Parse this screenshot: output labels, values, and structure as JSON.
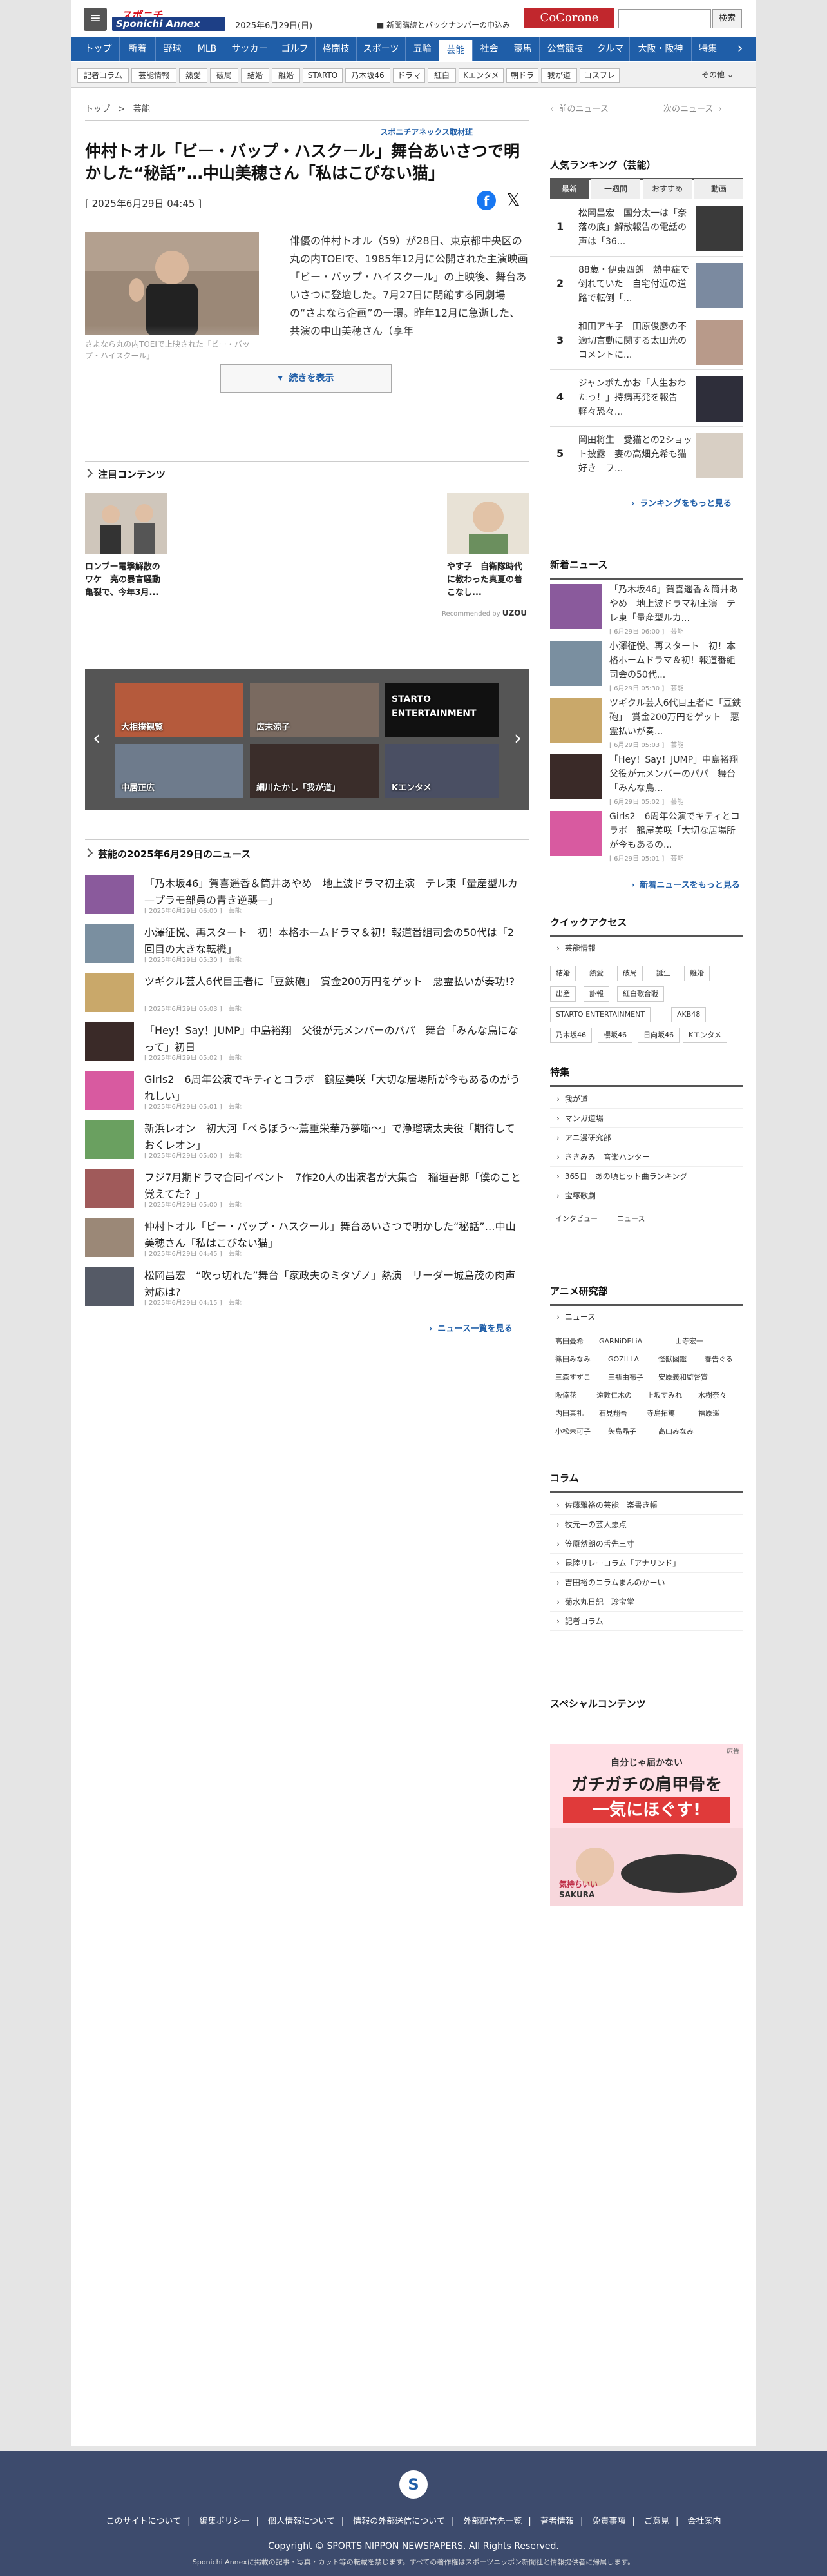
{
  "header": {
    "logo_top": "スポニチ",
    "logo_main": "Sponichi Annex",
    "date": "2025年6月29日(日)",
    "note": "■ 新聞購読とバックナンバーの申込み",
    "cocorone": "CoCorone",
    "search_button": "検索"
  },
  "nav": [
    "トップ",
    "新着",
    "野球",
    "MLB",
    "サッカー",
    "ゴルフ",
    "格闘技",
    "スポーツ",
    "五輪",
    "芸能",
    "社会",
    "競馬",
    "公営競技",
    "クルマ",
    "大阪・阪神",
    "特集"
  ],
  "subnav": {
    "items": [
      "記者コラム",
      "芸能情報",
      "熱愛",
      "破局",
      "結婚",
      "離婚",
      "STARTO",
      "乃木坂46",
      "ドラマ",
      "紅白",
      "Kエンタメ",
      "朝ドラ",
      "我が道",
      "コスプレ"
    ],
    "more": "その他"
  },
  "breadcrumb": {
    "top": "トップ",
    "sep": ">",
    "current": "芸能"
  },
  "pager": {
    "prev": "前のニュース",
    "next": "次のニュース"
  },
  "article": {
    "source": "スポニチアネックス取材班",
    "title": "仲村トオル「ビー・バップ・ハスクール」舞台あいさつで明かした“秘話”…中山美穂さん「私はこびない猫」",
    "date": "[ 2025年6月29日 04:45 ]",
    "body": "俳優の仲村トオル（59）が28日、東京都中央区の丸の内TOEIで、1985年12月に公開された主演映画「ビー・バップ・ハイスクール」の上映後、舞台あいさつに登壇した。7月27日に閉館する同劇場の“さよなら企画”の一環。昨年12月に急逝した、共演の中山美穂さん（享年",
    "caption": "さよなら丸の内TOEIで上映された「ビー・バップ・ハイスクール」",
    "more_button": "続きを表示"
  },
  "attention": {
    "title": "注目コンテンツ",
    "cards": [
      {
        "text": "ロンブー電撃解散のワケ　亮の暴言騒動 亀裂で、今年3月..."
      },
      {
        "text": "やす子　自衛隊時代に教わった真夏の着こなし..."
      }
    ],
    "recommended": "Recommended by",
    "recommended_brand": "UZOU"
  },
  "carousel": {
    "tiles": [
      "大相撲観覧",
      "広末涼子",
      "STARTO ENTERTAINMENT",
      "中居正広",
      "細川たかし「我が道」",
      "Kエンタメ"
    ]
  },
  "news_list": {
    "title": "芸能の2025年6月29日のニュース",
    "items": [
      {
        "title": "「乃木坂46」賀喜遥香＆筒井あやめ　地上波ドラマ初主演　テレ東「量産型ルカ—プラモ部員の青き逆襲—」",
        "date": "[ 2025年6月29日 06:00 ]　芸能"
      },
      {
        "title": "小澤征悦、再スタート　初！本格ホームドラマ＆初！報道番組司会の50代は「2回目の大きな転機」",
        "date": "[ 2025年6月29日 05:30 ]　芸能"
      },
      {
        "title": "ツギクル芸人6代目王者に「豆鉄砲」　賞金200万円をゲット　悪霊払いが奏功!?",
        "date": "[ 2025年6月29日 05:03 ]　芸能"
      },
      {
        "title": "「Hey！Say！JUMP」中島裕翔　父役が元メンバーのパパ　舞台「みんな鳥になって」初日",
        "date": "[ 2025年6月29日 05:02 ]　芸能"
      },
      {
        "title": "Girls2　6周年公演でキティとコラボ　鶴屋美咲「大切な居場所が今もあるのがうれしい」",
        "date": "[ 2025年6月29日 05:01 ]　芸能"
      },
      {
        "title": "新浜レオン　初大河「べらぼう〜蔦重栄華乃夢噺〜」で浄瑠璃太夫役「期待しておくレオン」",
        "date": "[ 2025年6月29日 05:00 ]　芸能"
      },
      {
        "title": "フジ7月期ドラマ合同イベント　7作20人の出演者が大集合　稲垣吾郎「僕のこと覚えてた？」",
        "date": "[ 2025年6月29日 05:00 ]　芸能"
      },
      {
        "title": "仲村トオル「ビー・バップ・ハスクール」舞台あいさつで明かした“秘話”…中山美穂さん「私はこびない猫」",
        "date": "[ 2025年6月29日 04:45 ]　芸能"
      },
      {
        "title": "松岡昌宏　“吹っ切れた”舞台「家政夫のミタゾノ」熱演　リーダー城島茂の肉声対応は?",
        "date": "[ 2025年6月29日 04:15 ]　芸能"
      }
    ],
    "more": "ニュース一覧を見る"
  },
  "ranking": {
    "title": "人気ランキング（芸能）",
    "tabs": [
      "最新",
      "一週間",
      "おすすめ",
      "動画"
    ],
    "items": [
      {
        "rank": "1",
        "text": "松岡昌宏　国分太一は「奈落の底」解散報告の電話の声は「36..."
      },
      {
        "rank": "2",
        "text": "88歳・伊東四朗　熱中症で倒れていた　自宅付近の道路で転倒「..."
      },
      {
        "rank": "3",
        "text": "和田アキ子　田原俊彦の不適切言動に関する太田光のコメントに..."
      },
      {
        "rank": "4",
        "text": "ジャンポたかお「人生おわたっ！」持病再発を報告　軽々恐々..."
      },
      {
        "rank": "5",
        "text": "岡田将生　愛猫との2ショット披露　妻の高畑充希も猫好き　フ..."
      }
    ],
    "more": "ランキングをもっと見る"
  },
  "new_news": {
    "title": "新着ニュース",
    "items": [
      {
        "text": "「乃木坂46」賀喜遥香＆筒井あやめ　地上波ドラマ初主演　テレ東「量産型ルカ...",
        "date": "[ 6月29日 06:00 ]　芸能"
      },
      {
        "text": "小澤征悦、再スタート　初！本格ホームドラマ＆初！報道番組司会の50代...",
        "date": "[ 6月29日 05:30 ]　芸能"
      },
      {
        "text": "ツギクル芸人6代目王者に「豆鉄砲」　賞金200万円をゲット　悪霊払いが奏...",
        "date": "[ 6月29日 05:03 ]　芸能"
      },
      {
        "text": "「Hey！Say！JUMP」中島裕翔　父役が元メンバーのパパ　舞台「みんな鳥...",
        "date": "[ 6月29日 05:02 ]　芸能"
      },
      {
        "text": "Girls2　6周年公演でキティとコラボ　鶴屋美咲「大切な居場所が今もあるの...",
        "date": "[ 6月29日 05:01 ]　芸能"
      }
    ],
    "more": "新着ニュースをもっと見る"
  },
  "quick_access": {
    "title": "クイックアクセス",
    "link": "芸能情報",
    "tags": [
      "結婚",
      "熱愛",
      "破局",
      "誕生",
      "離婚",
      "出産",
      "訃報",
      "紅白歌合戦",
      "STARTO ENTERTAINMENT",
      "AKB48",
      "乃木坂46",
      "櫻坂46",
      "日向坂46",
      "Kエンタメ"
    ]
  },
  "feature": {
    "title": "特集",
    "links": [
      "我が道",
      "マンガ道場",
      "アニ漫研究部",
      "ききみみ　音楽ハンター",
      "365日　あの頃ヒット曲ランキング",
      "宝塚歌劇"
    ],
    "tags": [
      "インタビュー",
      "ニュース"
    ]
  },
  "anime": {
    "title": "アニメ研究部",
    "link": "ニュース",
    "tags": [
      "高田憂希",
      "GARNiDELiA",
      "山寺宏一",
      "篠田みなみ",
      "GOZILLA",
      "怪獣図鑑",
      "春告ぐる",
      "三森すずこ",
      "三瓶由布子",
      "安原義和監督賞",
      "阪倖花",
      "遠敦仁木の",
      "上坂すみれ",
      "水樹奈々",
      "内田真礼",
      "石見翔吾",
      "寺島拓篤",
      "福原遥",
      "小松未可子",
      "矢島晶子",
      "高山みなみ"
    ]
  },
  "column": {
    "title": "コラム",
    "links": [
      "佐藤雅裕の芸能　楽書き帳",
      "牧元一の芸人悪点",
      "笠原然朗の舌先三寸",
      "昆陸リレーコラム「アナリンド」",
      "吉田裕のコラムまんのかーい",
      "菊水丸日記　珍宝堂",
      "記者コラム"
    ]
  },
  "special": {
    "title": "スペシャルコンテンツ"
  },
  "ad": {
    "label": "広告",
    "line1": "自分じゃ届かない",
    "line2": "ガチガチの肩甲骨を",
    "line3": "一気にほぐす!",
    "brand": "SAKURA",
    "small": "気持ちいい"
  },
  "footer": {
    "links": [
      "このサイトについて",
      "編集ポリシー",
      "個人情報について",
      "情報の外部送信について",
      "外部配信先一覧",
      "著者情報",
      "免責事項",
      "ご意見",
      "会社案内"
    ],
    "copyright": "Copyright © SPORTS NIPPON NEWSPAPERS. All Rights Reserved.",
    "notice": "Sponichi Annexに掲載の記事・写真・カット等の転載を禁じます。すべての著作権はスポーツニッポン新聞社と情報提供者に帰属します。",
    "logo": "S"
  }
}
